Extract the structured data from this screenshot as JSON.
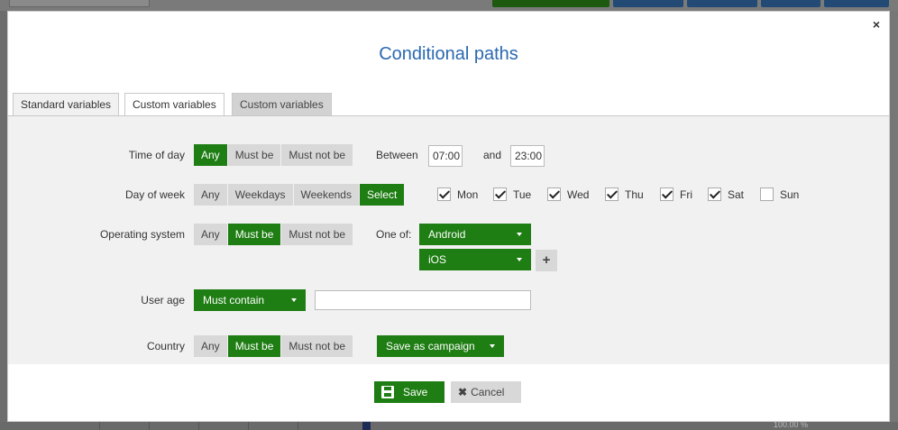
{
  "modal": {
    "title": "Conditional paths",
    "close_glyph": "×"
  },
  "tabs": [
    {
      "label": "Standard variables",
      "state": "active"
    },
    {
      "label": "Custom variables",
      "state": "normal"
    },
    {
      "label": "Custom variables",
      "state": "disabled"
    }
  ],
  "rows": {
    "time_of_day": {
      "label": "Time of day",
      "options": [
        "Any",
        "Must be",
        "Must not be"
      ],
      "selected": "Any",
      "between_label": "Between",
      "start": "07:00",
      "and_label": "and",
      "end": "23:00"
    },
    "day_of_week": {
      "label": "Day of week",
      "options": [
        "Any",
        "Weekdays",
        "Weekends",
        "Select"
      ],
      "selected": "Select",
      "days": [
        {
          "label": "Mon",
          "checked": true
        },
        {
          "label": "Tue",
          "checked": true
        },
        {
          "label": "Wed",
          "checked": true
        },
        {
          "label": "Thu",
          "checked": true
        },
        {
          "label": "Fri",
          "checked": true
        },
        {
          "label": "Sat",
          "checked": true
        },
        {
          "label": "Sun",
          "checked": false
        }
      ]
    },
    "operating_system": {
      "label": "Operating system",
      "options": [
        "Any",
        "Must be",
        "Must not be"
      ],
      "selected": "Must be",
      "one_of_label": "One of:",
      "values": [
        "Android",
        "iOS"
      ],
      "add_glyph": "+"
    },
    "user_age": {
      "label": "User age",
      "operator": "Must contain",
      "value": ""
    },
    "country": {
      "label": "Country",
      "options": [
        "Any",
        "Must be",
        "Must not be"
      ],
      "selected": "Must be",
      "save_as_label": "Save as campaign"
    }
  },
  "footer": {
    "save_label": "Save",
    "cancel_label": "Cancel"
  },
  "background": {
    "zoom_text": "100.00 %"
  },
  "colors": {
    "accent_green": "#1e7d13",
    "title_blue": "#2a69b0"
  }
}
